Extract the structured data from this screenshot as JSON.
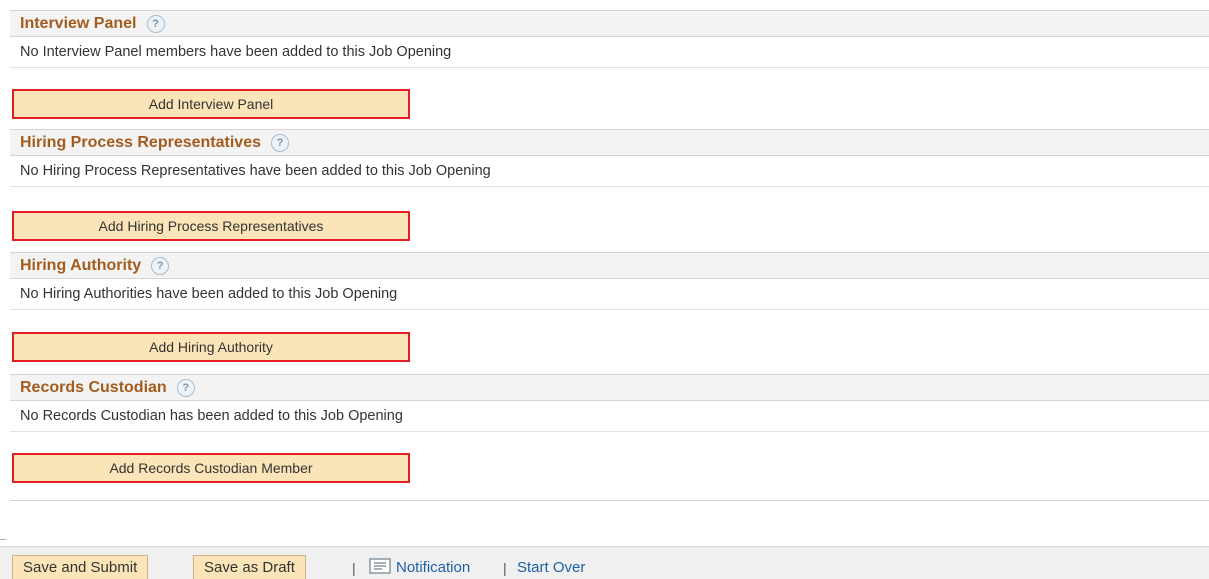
{
  "sections": [
    {
      "title": "Interview Panel",
      "message": "No Interview Panel members have been added to this Job Opening",
      "button_label": "Add Interview Panel"
    },
    {
      "title": "Hiring Process Representatives",
      "message": "No Hiring Process Representatives have been added to this Job Opening",
      "button_label": "Add Hiring Process Representatives"
    },
    {
      "title": "Hiring Authority",
      "message": "No Hiring Authorities have been added to this Job Opening",
      "button_label": "Add Hiring Authority"
    },
    {
      "title": "Records Custodian",
      "message": "No Records Custodian has been added to this Job Opening",
      "button_label": "Add Records Custodian Member"
    }
  ],
  "help_icon_glyph": "?",
  "footer": {
    "save_submit_label": "Save and Submit",
    "save_draft_label": "Save as Draft",
    "separator": "|",
    "notification_label": "Notification",
    "start_over_label": "Start Over"
  },
  "colors": {
    "section_title": "#a45c1e",
    "button_fill": "#fbe5b8",
    "highlight_border": "#e31e24",
    "link": "#1d5fa8"
  }
}
